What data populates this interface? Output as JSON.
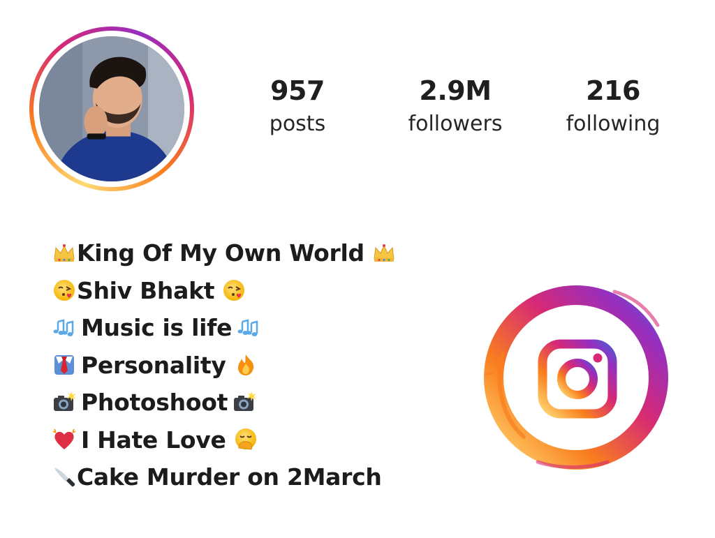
{
  "profile": {
    "stats": [
      {
        "value": "957",
        "label": "posts"
      },
      {
        "value": "2.9M",
        "label": "followers"
      },
      {
        "value": "216",
        "label": "following"
      }
    ]
  },
  "bio": {
    "lines": [
      {
        "text": "King Of My Own World",
        "emoji_before": "crown-icon",
        "emoji_after": "crown-icon"
      },
      {
        "text": "Shiv Bhakt",
        "emoji_before": "face-blowing-kiss-icon",
        "emoji_after": "face-blowing-kiss-icon"
      },
      {
        "text": "Music is life",
        "emoji_before": "musical-notes-icon",
        "emoji_after": "musical-notes-icon"
      },
      {
        "text": "Personality",
        "emoji_before": "necktie-icon",
        "emoji_after": "fire-icon"
      },
      {
        "text": "Photoshoot",
        "emoji_before": "camera-flash-icon",
        "emoji_after": "camera-flash-icon"
      },
      {
        "text": "I Hate Love",
        "emoji_before": "beating-heart-icon",
        "emoji_after": "hand-over-mouth-icon"
      },
      {
        "text": "Cake Murder on 2March",
        "emoji_before": "kitchen-knife-icon",
        "emoji_after": ""
      }
    ]
  },
  "colors": {
    "gradient_yellow": "#feda75",
    "gradient_orange": "#fa7e1e",
    "gradient_pink": "#d62976",
    "gradient_purple": "#962fbf",
    "gradient_blue": "#4f5bd5"
  }
}
